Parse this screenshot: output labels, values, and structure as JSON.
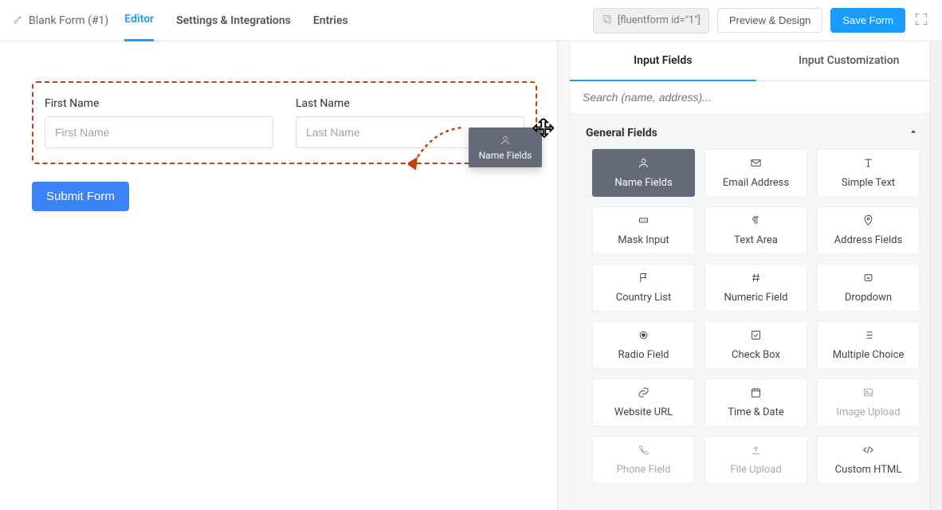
{
  "header": {
    "form_title": "Blank Form (#1)",
    "tabs": {
      "editor": "Editor",
      "settings": "Settings & Integrations",
      "entries": "Entries"
    },
    "shortcode": "[fluentform id=\"1\"]",
    "preview_btn": "Preview & Design",
    "save_btn": "Save Form"
  },
  "canvas": {
    "first_name_label": "First Name",
    "first_name_placeholder": "First Name",
    "last_name_label": "Last Name",
    "last_name_placeholder": "Last Name",
    "submit_label": "Submit Form"
  },
  "drag": {
    "label": "Name Fields"
  },
  "panel": {
    "tab_input": "Input Fields",
    "tab_custom": "Input Customization",
    "search_placeholder": "Search (name, address)...",
    "section_general": "General Fields",
    "tiles": {
      "name": "Name Fields",
      "email": "Email Address",
      "simple_text": "Simple Text",
      "mask": "Mask Input",
      "textarea": "Text Area",
      "address": "Address Fields",
      "country": "Country List",
      "numeric": "Numeric Field",
      "dropdown": "Dropdown",
      "radio": "Radio Field",
      "checkbox": "Check Box",
      "multi": "Multiple Choice",
      "url": "Website URL",
      "datetime": "Time & Date",
      "image": "Image Upload",
      "phone": "Phone Field",
      "file": "File Upload",
      "html": "Custom HTML"
    }
  }
}
